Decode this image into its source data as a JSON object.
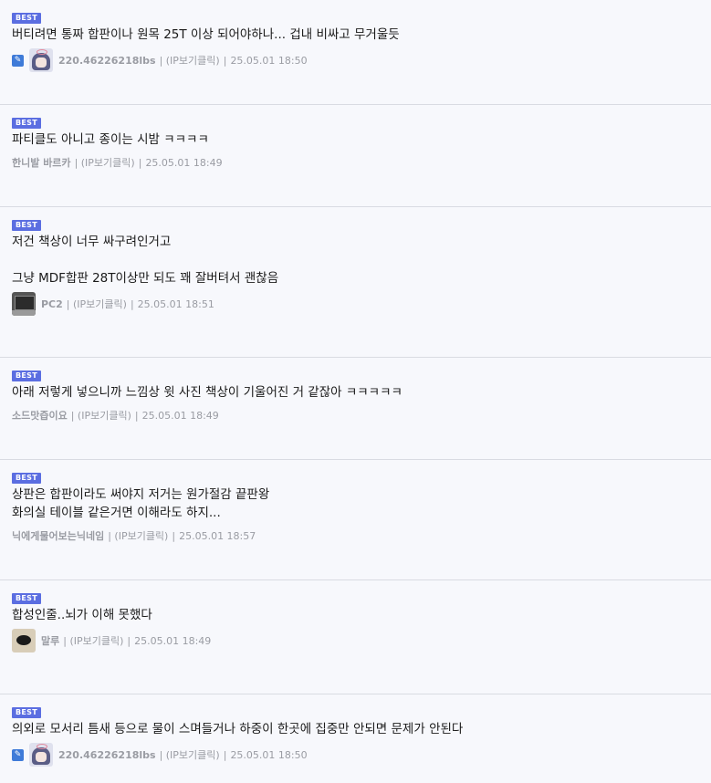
{
  "comments": [
    {
      "badge": "BEST",
      "text": "버티려면 통짜 합판이나 원목 25T 이상 되어야하나... 겁내 비싸고 무거울듯",
      "nick": "220.46226218lbs",
      "ip": "| (IP보기클릭)",
      "sep": "|",
      "date": "25.05.01 18:50",
      "pen": true,
      "avatar": "anime"
    },
    {
      "badge": "BEST",
      "text": "파티클도 아니고 종이는 시밤 ㅋㅋㅋㅋ",
      "nick": "한니발 바르카",
      "ip": "| (IP보기클릭)",
      "sep": "|",
      "date": "25.05.01 18:49",
      "pen": false,
      "avatar": ""
    },
    {
      "badge": "BEST",
      "text": "저건 책상이 너무 싸구려인거고\n\n그냥 MDF합판 28T이상만 되도 꽤 잘버텨서 괜찮음",
      "nick": "PC2",
      "ip": "| (IP보기클릭)",
      "sep": "|",
      "date": "25.05.01 18:51",
      "pen": false,
      "avatar": "pc"
    },
    {
      "badge": "BEST",
      "text": "아래 저렇게 넣으니까 느낌상 윗 사진 책상이 기울어진 거 같잖아 ㅋㅋㅋㅋㅋ",
      "nick": "소드맛즙이요",
      "ip": "| (IP보기클릭)",
      "sep": "|",
      "date": "25.05.01 18:49",
      "pen": false,
      "avatar": ""
    },
    {
      "badge": "BEST",
      "text": "상판은 합판이라도 써야지 저거는 원가절감 끝판왕\n화의실 테이블 같은거면 이해라도 하지...",
      "nick": "닉에게물어보는닉네임",
      "ip": "| (IP보기클릭)",
      "sep": "|",
      "date": "25.05.01 18:57",
      "pen": false,
      "avatar": ""
    },
    {
      "badge": "BEST",
      "text": "합성인줄..뇌가 이해 못했다",
      "nick": "말루",
      "ip": "| (IP보기클릭)",
      "sep": "|",
      "date": "25.05.01 18:49",
      "pen": false,
      "avatar": "donut"
    },
    {
      "badge": "BEST",
      "text": "의외로 모서리 틈새 등으로 물이 스며들거나 하중이 한곳에 집중만 안되면 문제가 안된다",
      "nick": "220.46226218lbs",
      "ip": "| (IP보기클릭)",
      "sep": "|",
      "date": "25.05.01 18:50",
      "pen": true,
      "avatar": "anime"
    }
  ]
}
